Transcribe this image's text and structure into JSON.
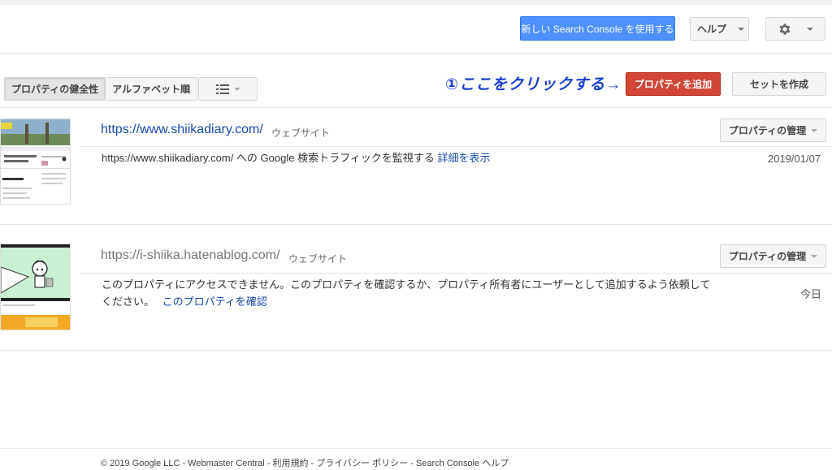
{
  "header": {
    "new_console_label": "新しい Search Console を使用する",
    "help_label": "ヘルプ",
    "settings_icon": "gear-icon",
    "accent_blue": "#4d90fe"
  },
  "annotation": {
    "text": "①ここをクリックする→"
  },
  "toolbar": {
    "sort_health_label": "プロパティの健全性",
    "sort_alpha_label": "アルファベット順",
    "view_icon": "list-view-icon",
    "add_property_label": "プロパティを追加",
    "add_property_color": "#d14836",
    "create_set_label": "セットを作成"
  },
  "properties": [
    {
      "url": "https://www.shiikadiary.com/",
      "kind": "ウェブサイト",
      "manage_label": "プロパティの管理",
      "description": "https://www.shiikadiary.com/ への Google 検索トラフィックを監視する",
      "link_text": "詳細を表示",
      "date": "2019/01/07"
    },
    {
      "url": "https://i-shiika.hatenablog.com/",
      "kind": "ウェブサイト",
      "manage_label": "プロパティの管理",
      "description": "このプロパティにアクセスできません。このプロパティを確認するか、プロパティ所有者にユーザーとして追加するよう依頼してください。",
      "link_text": "このプロパティを確認",
      "date": "今日"
    }
  ],
  "footer": {
    "text": "© 2019 Google LLC - Webmaster Central - 利用規約 - プライバシー ポリシー - Search Console ヘルプ"
  }
}
